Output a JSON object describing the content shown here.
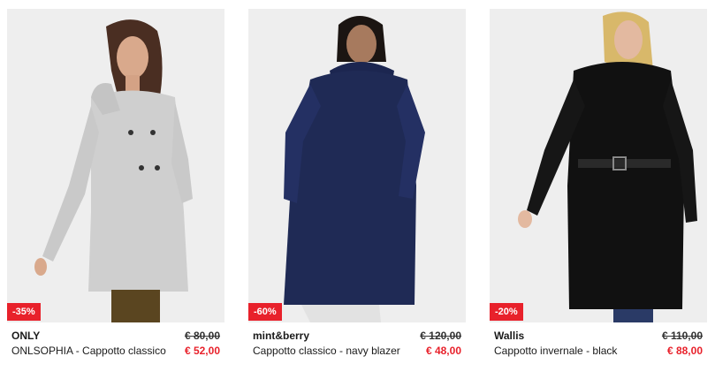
{
  "products": [
    {
      "brand": "ONLY",
      "name": "ONLSOPHIA - Cappotto classico",
      "old_price": "€ 80,00",
      "price": "€ 52,00",
      "discount": "-35%",
      "image_icon": "grey-wool-coat-image",
      "coat_color": "#cfcfcf"
    },
    {
      "brand": "mint&berry",
      "name": "Cappotto classico - navy blazer",
      "old_price": "€ 120,00",
      "price": "€ 48,00",
      "discount": "-60%",
      "image_icon": "navy-coat-image",
      "coat_color": "#1f2a55"
    },
    {
      "brand": "Wallis",
      "name": "Cappotto invernale - black",
      "old_price": "€ 110,00",
      "price": "€ 88,00",
      "discount": "-20%",
      "image_icon": "black-puffer-coat-image",
      "coat_color": "#111111"
    }
  ],
  "colors": {
    "sale_red": "#e8212b",
    "background": "#ffffff",
    "photo_bg": "#eeeeee"
  }
}
